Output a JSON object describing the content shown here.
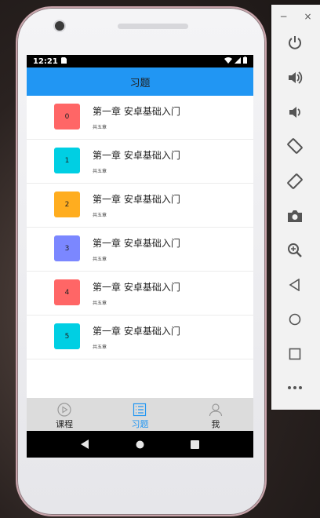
{
  "status_bar": {
    "time": "12:21"
  },
  "header": {
    "title": "习题"
  },
  "chapters": [
    {
      "number": "0",
      "title": "第一章 安卓基础入门",
      "subtitle": "共五章",
      "color": "#ff6666"
    },
    {
      "number": "1",
      "title": "第一章 安卓基础入门",
      "subtitle": "共五章",
      "color": "#00cfe3"
    },
    {
      "number": "2",
      "title": "第一章 安卓基础入门",
      "subtitle": "共五章",
      "color": "#ffad1f"
    },
    {
      "number": "3",
      "title": "第一章 安卓基础入门",
      "subtitle": "共五章",
      "color": "#7b87ff"
    },
    {
      "number": "4",
      "title": "第一章 安卓基础入门",
      "subtitle": "共五章",
      "color": "#ff6666"
    },
    {
      "number": "5",
      "title": "第一章 安卓基础入门",
      "subtitle": "共五章",
      "color": "#00cfe3"
    }
  ],
  "tabs": [
    {
      "label": "课程",
      "icon": "play-circle-icon",
      "active": false
    },
    {
      "label": "习题",
      "icon": "list-icon",
      "active": true
    },
    {
      "label": "我",
      "icon": "person-icon",
      "active": false
    }
  ],
  "colors": {
    "accent": "#2196f3",
    "tab_background": "#dcdcdc"
  },
  "emulator_panel": {
    "window_buttons": [
      "−",
      "×"
    ],
    "buttons": [
      "power-icon",
      "volume-up-icon",
      "volume-down-icon",
      "rotate-left-icon",
      "rotate-right-icon",
      "camera-icon",
      "zoom-icon",
      "back-icon",
      "home-icon",
      "overview-icon",
      "more-icon"
    ]
  }
}
